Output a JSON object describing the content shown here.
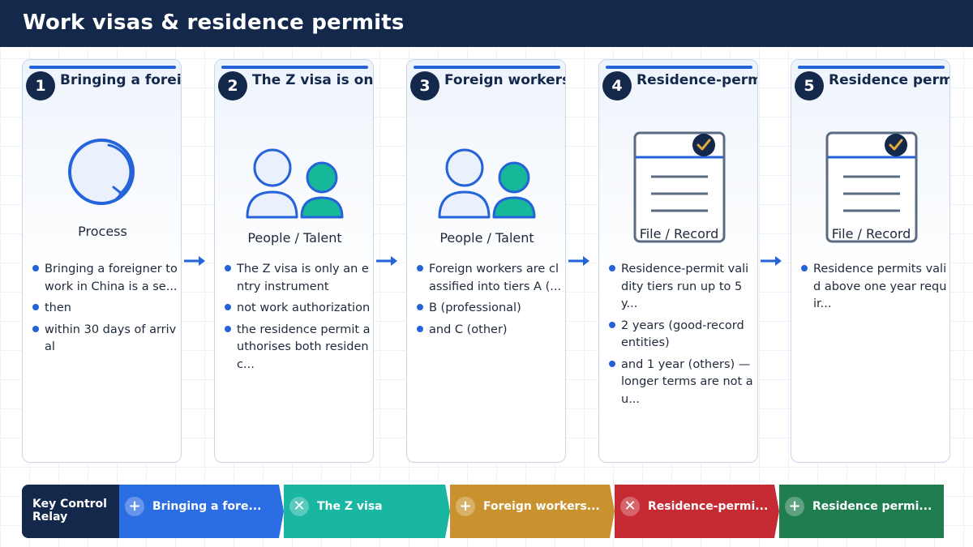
{
  "header": {
    "title": "Work visas & residence permits"
  },
  "colors": {
    "navy": "#14284b",
    "accent": "#2563d9",
    "teal": "#17b79a",
    "relay": [
      "#2b6de2",
      "#19b6a1",
      "#c9922e",
      "#c62a33",
      "#1f7d4f"
    ]
  },
  "steps": [
    {
      "number": "1",
      "title": "Bringing a foreigne...",
      "icon": "process-ring-icon",
      "label": "Process",
      "bullets": [
        "Bringing a foreigner to work in China is a se...",
        "then",
        "within 30 days of arrival"
      ]
    },
    {
      "number": "2",
      "title": "The Z visa is only...",
      "icon": "people-icon",
      "label": "People / Talent",
      "bullets": [
        "The Z visa is only an entry instrument",
        "not work authorization",
        "the residence permit authorises both residenc..."
      ]
    },
    {
      "number": "3",
      "title": "Foreign workers are...",
      "icon": "people-icon",
      "label": "People / Talent",
      "bullets": [
        "Foreign workers are classified into tiers A (...",
        "B (professional)",
        "and C (other)"
      ]
    },
    {
      "number": "4",
      "title": "Residence-permit va...",
      "icon": "document-check-icon",
      "label": "File / Record",
      "bullets": [
        "Residence-permit validity tiers run up to 5 y...",
        "2 years (good-record entities)",
        "and 1 year (others) — longer terms are not au..."
      ]
    },
    {
      "number": "5",
      "title": "Residence permits v...",
      "icon": "document-check-icon",
      "label": "File / Record",
      "bullets": [
        "Residence permits valid above one year requir..."
      ]
    }
  ],
  "relay": {
    "title": "Key Control Relay",
    "segments": [
      {
        "icon": "plus-icon",
        "symbol": "+",
        "label": "Bringing a fore..."
      },
      {
        "icon": "cross-icon",
        "symbol": "✕",
        "label": "The Z visa"
      },
      {
        "icon": "plus-icon",
        "symbol": "+",
        "label": "Foreign workers..."
      },
      {
        "icon": "cross-icon",
        "symbol": "✕",
        "label": "Residence-permi..."
      },
      {
        "icon": "plus-icon",
        "symbol": "+",
        "label": "Residence permi..."
      }
    ]
  }
}
